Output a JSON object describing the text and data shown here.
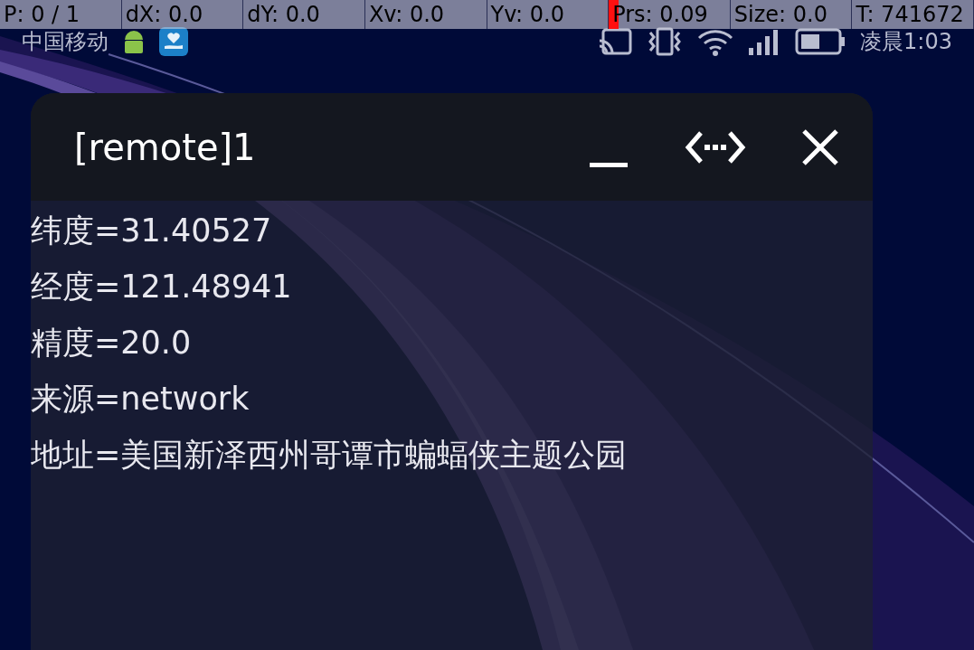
{
  "pointer_overlay": {
    "cells": [
      {
        "label": "P: 0 / 1"
      },
      {
        "label": "dX: 0.0"
      },
      {
        "label": "dY: 0.0"
      },
      {
        "label": "Xv: 0.0"
      },
      {
        "label": "Yv: 0.0"
      },
      {
        "label": "Prs: 0.09",
        "level": 0.08
      },
      {
        "label": "Size: 0.0"
      },
      {
        "label": "T: 741672"
      }
    ]
  },
  "status_bar": {
    "carrier": "中国移动",
    "time": "凌晨1:03"
  },
  "window": {
    "title": "[remote]1",
    "lines": [
      "纬度=31.40527",
      "经度=121.48941",
      "精度=20.0",
      "来源=network",
      "地址=美国新泽西州哥谭市蝙蝠侠主题公园"
    ]
  }
}
